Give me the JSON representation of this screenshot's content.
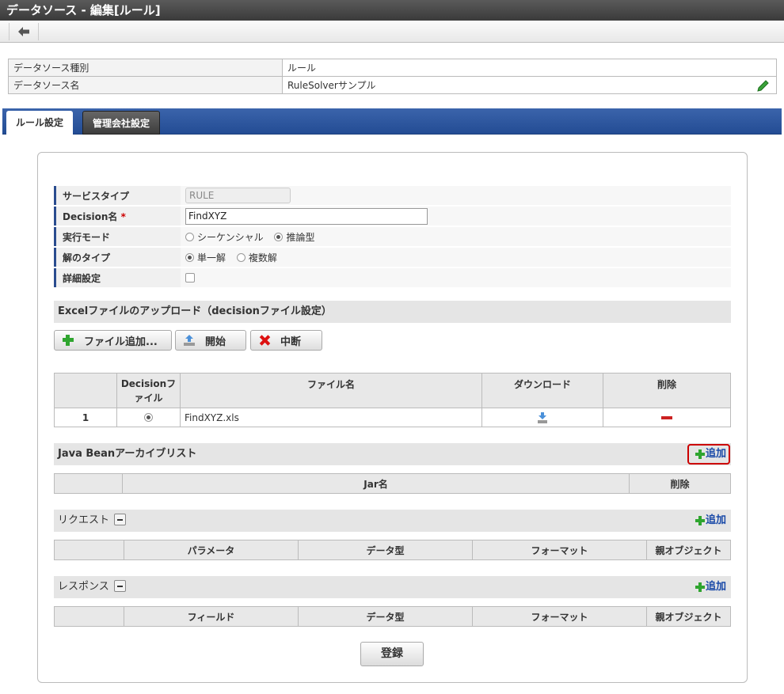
{
  "window": {
    "title": "データソース - 編集[ルール]"
  },
  "info": {
    "type_label": "データソース種別",
    "type_value": "ルール",
    "name_label": "データソース名",
    "name_value": "RuleSolverサンプル"
  },
  "tabs": {
    "rule": "ルール設定",
    "company": "管理会社設定"
  },
  "form": {
    "service_type_label": "サービスタイプ",
    "service_type_value": "RULE",
    "decision_label": "Decision名",
    "required_mark": "*",
    "decision_value": "FindXYZ",
    "mode_label": "実行モード",
    "mode_opt1": "シーケンシャル",
    "mode_opt2": "推論型",
    "solution_label": "解のタイプ",
    "solution_opt1": "単一解",
    "solution_opt2": "複数解",
    "detail_label": "詳細設定"
  },
  "excel": {
    "title": "Excelファイルのアップロード（decisionファイル設定）",
    "add_file": "ファイル追加...",
    "start": "開始",
    "stop": "中断",
    "headers": {
      "decision_line1": "Decisionフ",
      "decision_line2": "ァイル",
      "filename": "ファイル名",
      "download": "ダウンロード",
      "delete": "削除"
    },
    "rows": [
      {
        "num": "1",
        "filename": "FindXYZ.xls"
      }
    ]
  },
  "javabean": {
    "title": "Java Beanアーカイブリスト",
    "add": "追加",
    "headers": {
      "jar": "Jar名",
      "delete": "削除"
    }
  },
  "request": {
    "title": "リクエスト",
    "add": "追加",
    "headers": {
      "param": "パラメータ",
      "datatype": "データ型",
      "format": "フォーマット",
      "parent": "親オブジェクト"
    }
  },
  "response": {
    "title": "レスポンス",
    "add": "追加",
    "headers": {
      "field": "フィールド",
      "datatype": "データ型",
      "format": "フォーマット",
      "parent": "親オブジェクト"
    }
  },
  "submit": "登録",
  "colors": {
    "tab_bar": "#2a5298",
    "required": "#cc0000",
    "add_link": "#1a4aa8",
    "highlight": "#cc0000"
  }
}
